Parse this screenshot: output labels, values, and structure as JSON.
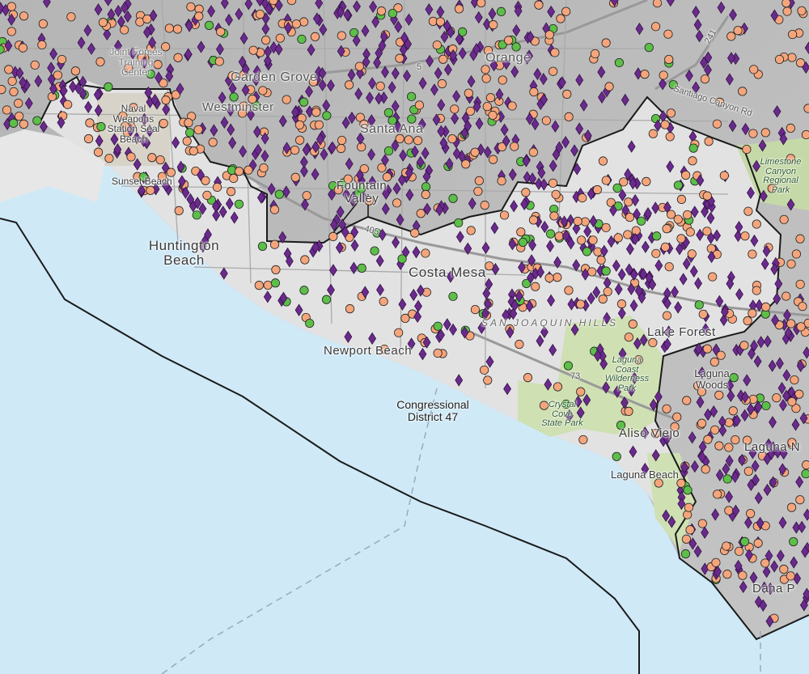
{
  "map": {
    "district_label": {
      "line1": "Congressional",
      "line2": "District 47"
    },
    "places": {
      "huntington_beach": {
        "line1": "Huntington",
        "line2": "Beach"
      },
      "costa_mesa": "Costa Mesa",
      "newport_beach": "Newport Beach",
      "fountain_valley": {
        "line1": "Fountain",
        "line2": "Valley"
      },
      "sunset_beach": "Sunset Beach",
      "lake_forest": "Lake Forest",
      "aliso_viejo": "Aliso Viejo",
      "laguna_beach": "Laguna Beach",
      "laguna_woods": {
        "line1": "Laguna",
        "line2": "Woods"
      },
      "laguna_niguel": "Laguna N",
      "dana_point": "Dana P",
      "garden_grove": "Garden Grove",
      "westminster": "Westminster",
      "santa_ana": "Santa Ana",
      "orange": "Orange"
    },
    "parks": {
      "naval_weapons": {
        "line1": "Naval",
        "line2": "Weapons",
        "line3": "Station Seal",
        "line4": "Beach"
      },
      "joint_forces": {
        "line1": "Joint Forces",
        "line2": "Training",
        "line3": "Center"
      },
      "laguna_coast": {
        "line1": "Laguna",
        "line2": "Coast",
        "line3": "Wilderness",
        "line4": "Park"
      },
      "crystal_cove": {
        "line1": "Crystal",
        "line2": "Cove",
        "line3": "State Park"
      },
      "limestone": {
        "line1": "Limestone",
        "line2": "Canyon",
        "line3": "Regional",
        "line4": "Park"
      }
    },
    "roads": {
      "santiago": "Santiago Canyon Rd",
      "hills": "SAN JOAQUIN HILLS",
      "hwy73": "73",
      "hwy241": "241",
      "hwy405": "405",
      "hwy5": "5"
    },
    "colors": {
      "ocean": "#cfe9f7",
      "land_urban": "#bdbdbd",
      "land_district": "#e6e6e6",
      "park_green": "#c9ddb0",
      "diamond_purple": "#6a2a8c",
      "circle_orange": "#f5a57c",
      "circle_green": "#5cbf48",
      "boundary": "#1a1a1a"
    },
    "marker_types": [
      "purple-diamond",
      "orange-circle",
      "green-circle"
    ]
  }
}
